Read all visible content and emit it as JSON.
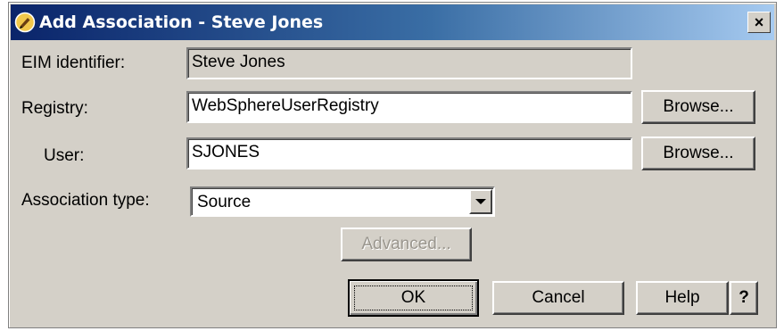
{
  "window": {
    "title": "Add Association - Steve Jones",
    "close_label": "×"
  },
  "form": {
    "eim_label": "EIM identifier:",
    "eim_value": "Steve Jones",
    "registry_label": "Registry:",
    "registry_value": "WebSphereUserRegistry",
    "user_label": "User:",
    "user_value": "SJONES",
    "assoc_type_label": "Association type:",
    "assoc_type_value": "Source"
  },
  "buttons": {
    "browse_registry": "Browse...",
    "browse_user": "Browse...",
    "advanced": "Advanced...",
    "ok": "OK",
    "cancel": "Cancel",
    "help": "Help",
    "whats_this": "?"
  },
  "icons": {
    "title_icon": "iseries-navigator-icon",
    "close": "close-icon",
    "dropdown": "chevron-down-icon"
  },
  "colors": {
    "titlebar_start": "#0a246a",
    "titlebar_end": "#a6caf0",
    "dialog_bg": "#d4d0c8"
  }
}
